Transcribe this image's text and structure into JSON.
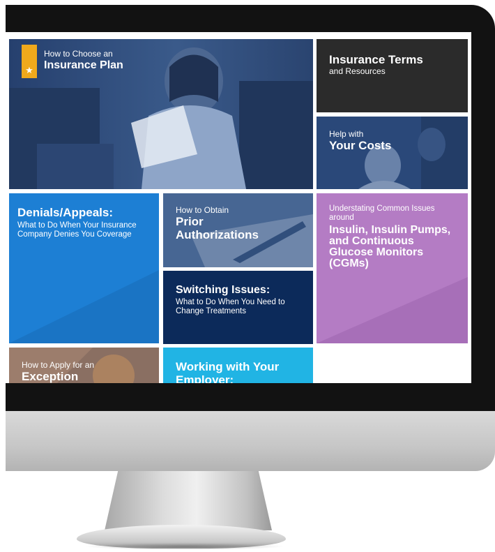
{
  "tiles": {
    "plan": {
      "subtitle": "How to Choose an",
      "title": "Insurance Plan",
      "icon": "star-icon",
      "icon_glyph": "★"
    },
    "terms": {
      "title": "Insurance Terms",
      "subtitle": "and Resources"
    },
    "costs": {
      "subtitle": "Help with",
      "title": "Your Costs"
    },
    "denials": {
      "title": "Denials/Appeals:",
      "description": "What to Do When Your Insurance Company Denies You Coverage"
    },
    "prior": {
      "subtitle": "How to Obtain",
      "title_line1": "Prior",
      "title_line2": "Authorizations"
    },
    "switching": {
      "title": "Switching Issues:",
      "description": "What to Do When You Need to Change Treatments"
    },
    "insulin": {
      "subtitle": "Understating Common Issues around",
      "title": "Insulin, Insulin Pumps, and Continuous Glucose Monitors (CGMs)"
    },
    "exception": {
      "subtitle": "How to Apply for an",
      "title": "Exception"
    },
    "employer": {
      "title": "Working with Your Employer:"
    }
  },
  "colors": {
    "accent_star": "#f0a91c",
    "terms_bg": "#2b2b2b",
    "denials_bg": "#1d7fd4",
    "switching_bg": "#0c2a5a",
    "insulin_bg": "#b47cc4",
    "employer_bg": "#21b4e4"
  }
}
